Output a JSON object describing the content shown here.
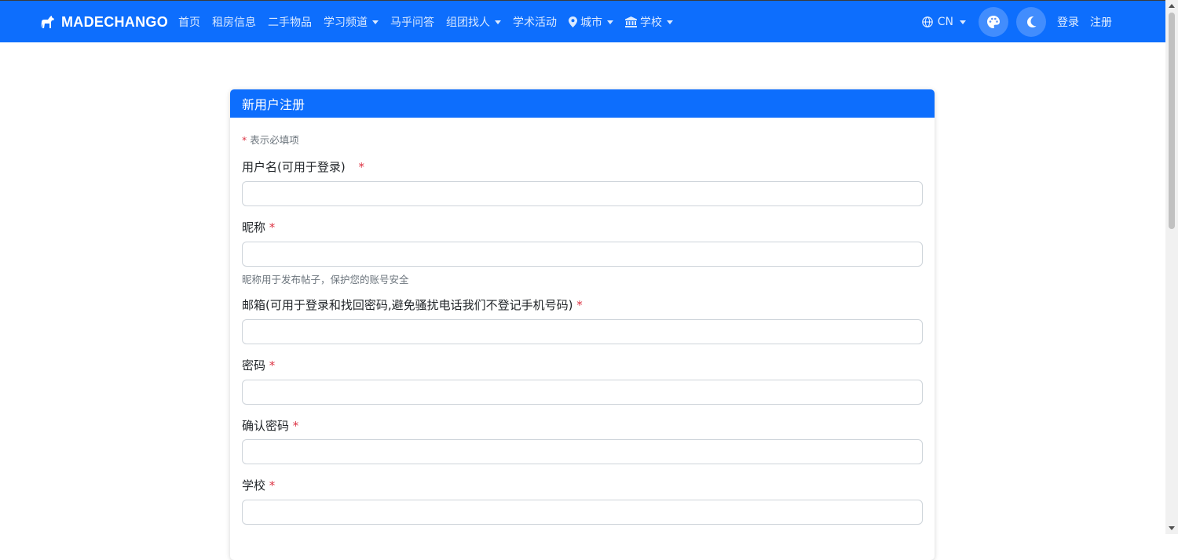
{
  "navbar": {
    "brand": "MADECHANGO",
    "links": [
      {
        "label": "首页",
        "dropdown": false,
        "icon": null
      },
      {
        "label": "租房信息",
        "dropdown": false,
        "icon": null
      },
      {
        "label": "二手物品",
        "dropdown": false,
        "icon": null
      },
      {
        "label": "学习频道",
        "dropdown": true,
        "icon": null
      },
      {
        "label": "马乎问答",
        "dropdown": false,
        "icon": null
      },
      {
        "label": "组团找人",
        "dropdown": true,
        "icon": null
      },
      {
        "label": "学术活动",
        "dropdown": false,
        "icon": null
      },
      {
        "label": "城市",
        "dropdown": true,
        "icon": "map-pin-icon"
      },
      {
        "label": "学校",
        "dropdown": true,
        "icon": "university-icon"
      }
    ],
    "language": "CN",
    "theme_button_icon": "palette-icon",
    "dark_mode_icon": "moon-icon",
    "login": "登录",
    "register": "注册"
  },
  "form": {
    "title": "新用户注册",
    "required_note_star": "*",
    "required_note": "表示必填项",
    "fields": [
      {
        "label": "用户名(可用于登录)",
        "required_mark": "*",
        "value": "",
        "help": ""
      },
      {
        "label": "昵称",
        "required_mark": "*",
        "value": "",
        "help": "昵称用于发布帖子，保护您的账号安全"
      },
      {
        "label": "邮箱(可用于登录和找回密码,避免骚扰电话我们不登记手机号码)",
        "required_mark": "*",
        "value": "",
        "help": ""
      },
      {
        "label": "密码",
        "required_mark": "*",
        "value": "",
        "help": ""
      },
      {
        "label": "确认密码",
        "required_mark": "*",
        "value": "",
        "help": ""
      },
      {
        "label": "学校",
        "required_mark": "*",
        "value": "",
        "help": ""
      }
    ]
  },
  "colors": {
    "primary": "#0d6efd",
    "required": "#dc3545",
    "muted": "#6c757d"
  }
}
